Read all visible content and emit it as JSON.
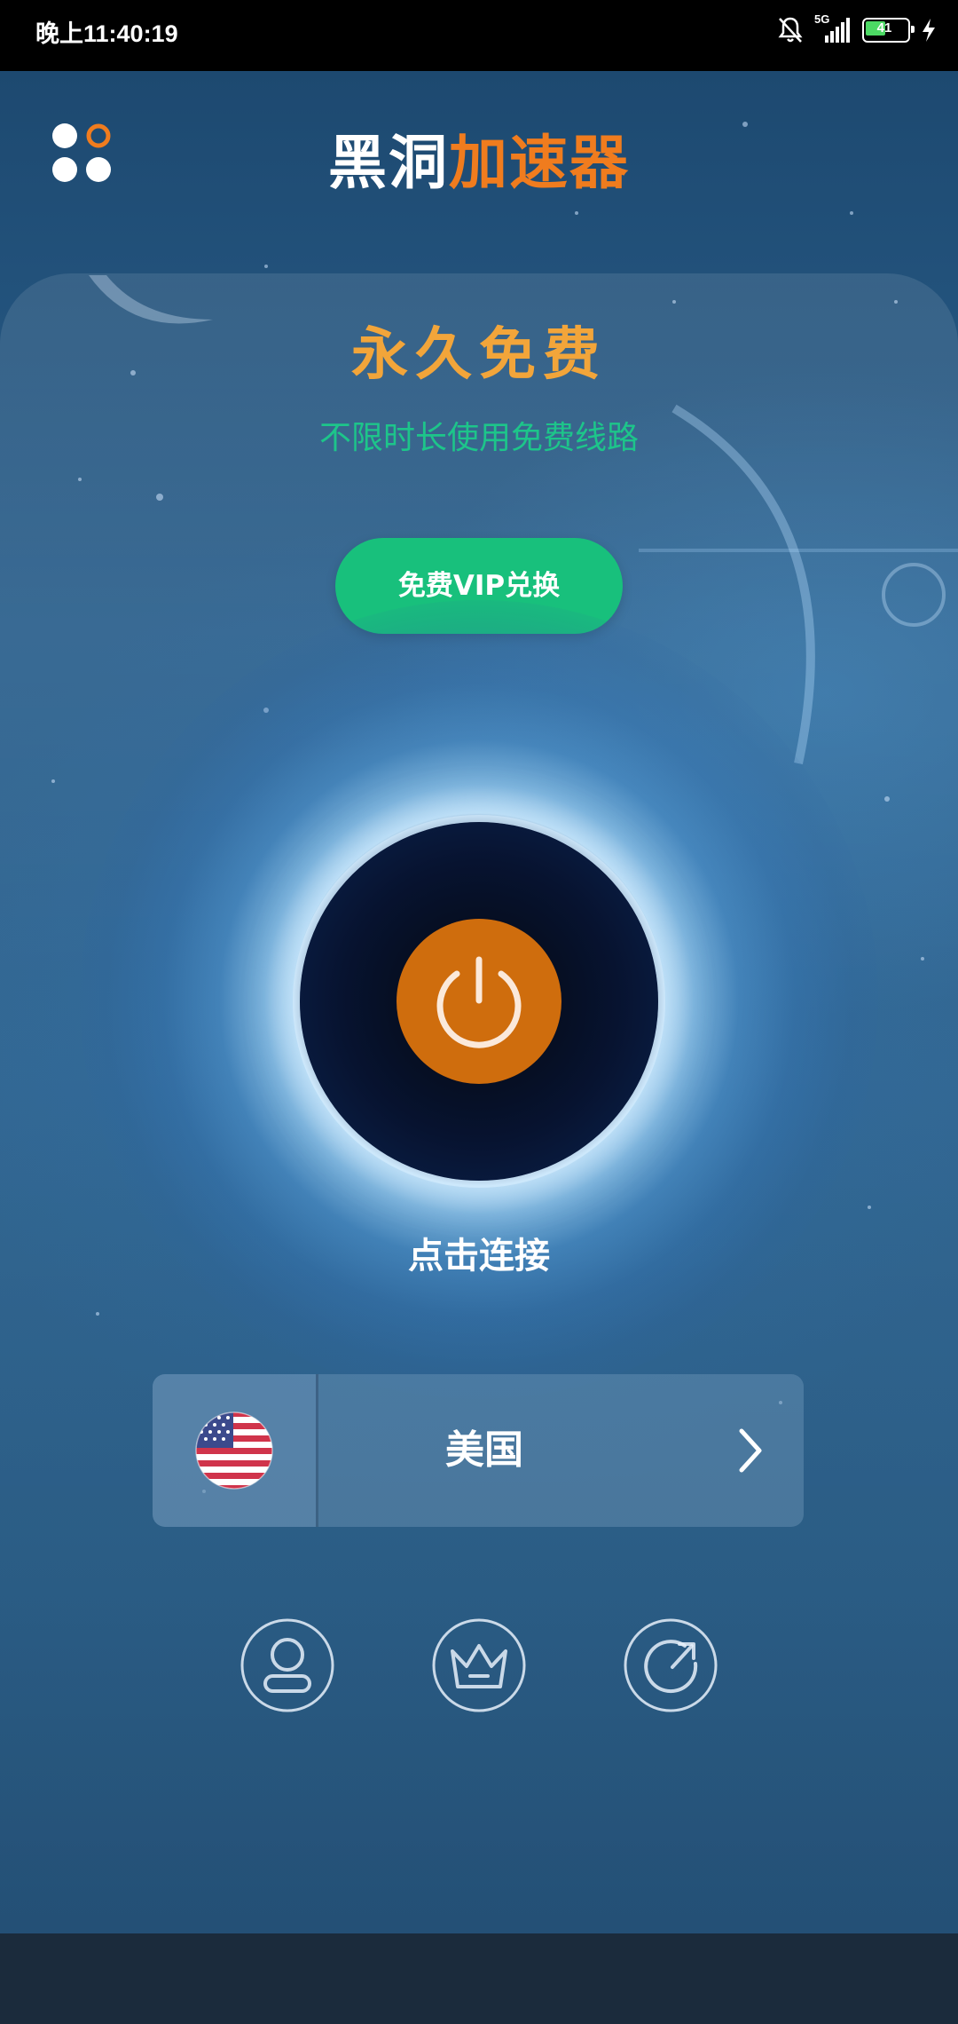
{
  "status_bar": {
    "time": "晚上11:40:19",
    "network": "5G",
    "battery": "41"
  },
  "header": {
    "title_part1": "黑洞",
    "title_part2": "加速器",
    "menu_icon": "apps-grid-icon"
  },
  "main": {
    "headline": "永久免费",
    "subline": "不限时长使用免费线路",
    "vip_button": "免费VIP兑换",
    "connect_label": "点击连接"
  },
  "region": {
    "name": "美国",
    "flag_icon": "us-flag-icon"
  },
  "bottom_nav": [
    {
      "icon": "user-icon"
    },
    {
      "icon": "crown-icon"
    },
    {
      "icon": "share-icon"
    }
  ],
  "colors": {
    "accent_orange": "#f07c1e",
    "power_orange": "#cf6d0d",
    "green": "#18c07c",
    "headline_gold": "#f2a53a"
  }
}
